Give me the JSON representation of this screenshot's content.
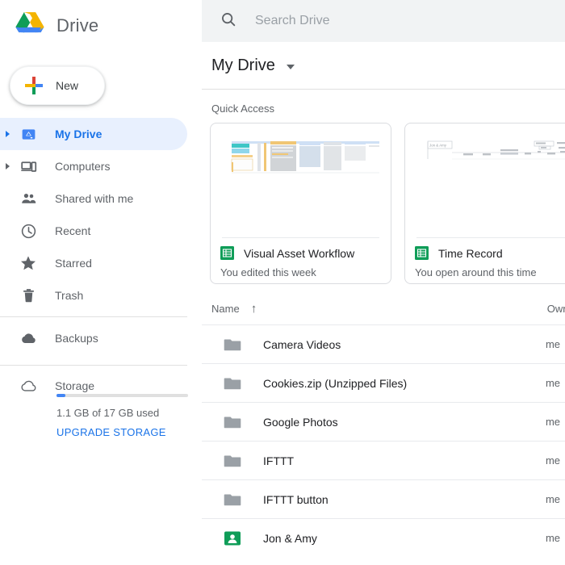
{
  "brand": {
    "title": "Drive",
    "logo_icon": "google-drive-logo"
  },
  "new_button": {
    "label": "New",
    "icon": "plus-icon"
  },
  "sidebar": {
    "items": [
      {
        "label": "My Drive",
        "icon": "my-drive-icon",
        "active": true,
        "caret": true
      },
      {
        "label": "Computers",
        "icon": "computers-icon",
        "active": false,
        "caret": true
      },
      {
        "label": "Shared with me",
        "icon": "people-icon",
        "active": false,
        "caret": false
      },
      {
        "label": "Recent",
        "icon": "clock-icon",
        "active": false,
        "caret": false
      },
      {
        "label": "Starred",
        "icon": "star-icon",
        "active": false,
        "caret": false
      },
      {
        "label": "Trash",
        "icon": "trash-icon",
        "active": false,
        "caret": false
      }
    ],
    "backups": {
      "label": "Backups",
      "icon": "cloud-filled-icon"
    },
    "storage": {
      "label": "Storage",
      "icon": "cloud-outline-icon",
      "used_text": "1.1 GB of 17 GB used",
      "upgrade_label": "UPGRADE STORAGE",
      "percent_used": 6.5,
      "bar_color": "#4285f4",
      "track_color": "#e0e0e0"
    }
  },
  "search": {
    "placeholder": "Search Drive",
    "value": "",
    "icon": "search-icon"
  },
  "drive_header": {
    "title": "My Drive",
    "caret_icon": "chevron-down-icon"
  },
  "quick_access": {
    "section_label": "Quick Access",
    "cards": [
      {
        "name": "Visual Asset Workflow",
        "subtitle": "You edited this week",
        "icon": "google-sheets-icon",
        "thumb": "spreadsheet"
      },
      {
        "name": "Time Record",
        "subtitle": "You open around this time",
        "icon": "google-sheets-icon",
        "thumb": "spreadsheet-sparse"
      }
    ]
  },
  "file_list": {
    "columns": {
      "name": "Name",
      "owner": "Owner"
    },
    "sort_icon": "arrow-up-icon",
    "rows": [
      {
        "name": "Camera Videos",
        "owner": "me",
        "icon": "folder-icon"
      },
      {
        "name": "Cookies.zip (Unzipped Files)",
        "owner": "me",
        "icon": "folder-icon"
      },
      {
        "name": "Google Photos",
        "owner": "me",
        "icon": "folder-icon"
      },
      {
        "name": "IFTTT",
        "owner": "me",
        "icon": "folder-icon"
      },
      {
        "name": "IFTTT button",
        "owner": "me",
        "icon": "folder-icon"
      },
      {
        "name": "Jon & Amy",
        "owner": "me",
        "icon": "google-contacts-icon"
      }
    ]
  },
  "colors": {
    "accent": "#1a73e8",
    "active_bg": "#e8f0fe",
    "text_secondary": "#5f6368",
    "sheets_green": "#0f9d58"
  }
}
